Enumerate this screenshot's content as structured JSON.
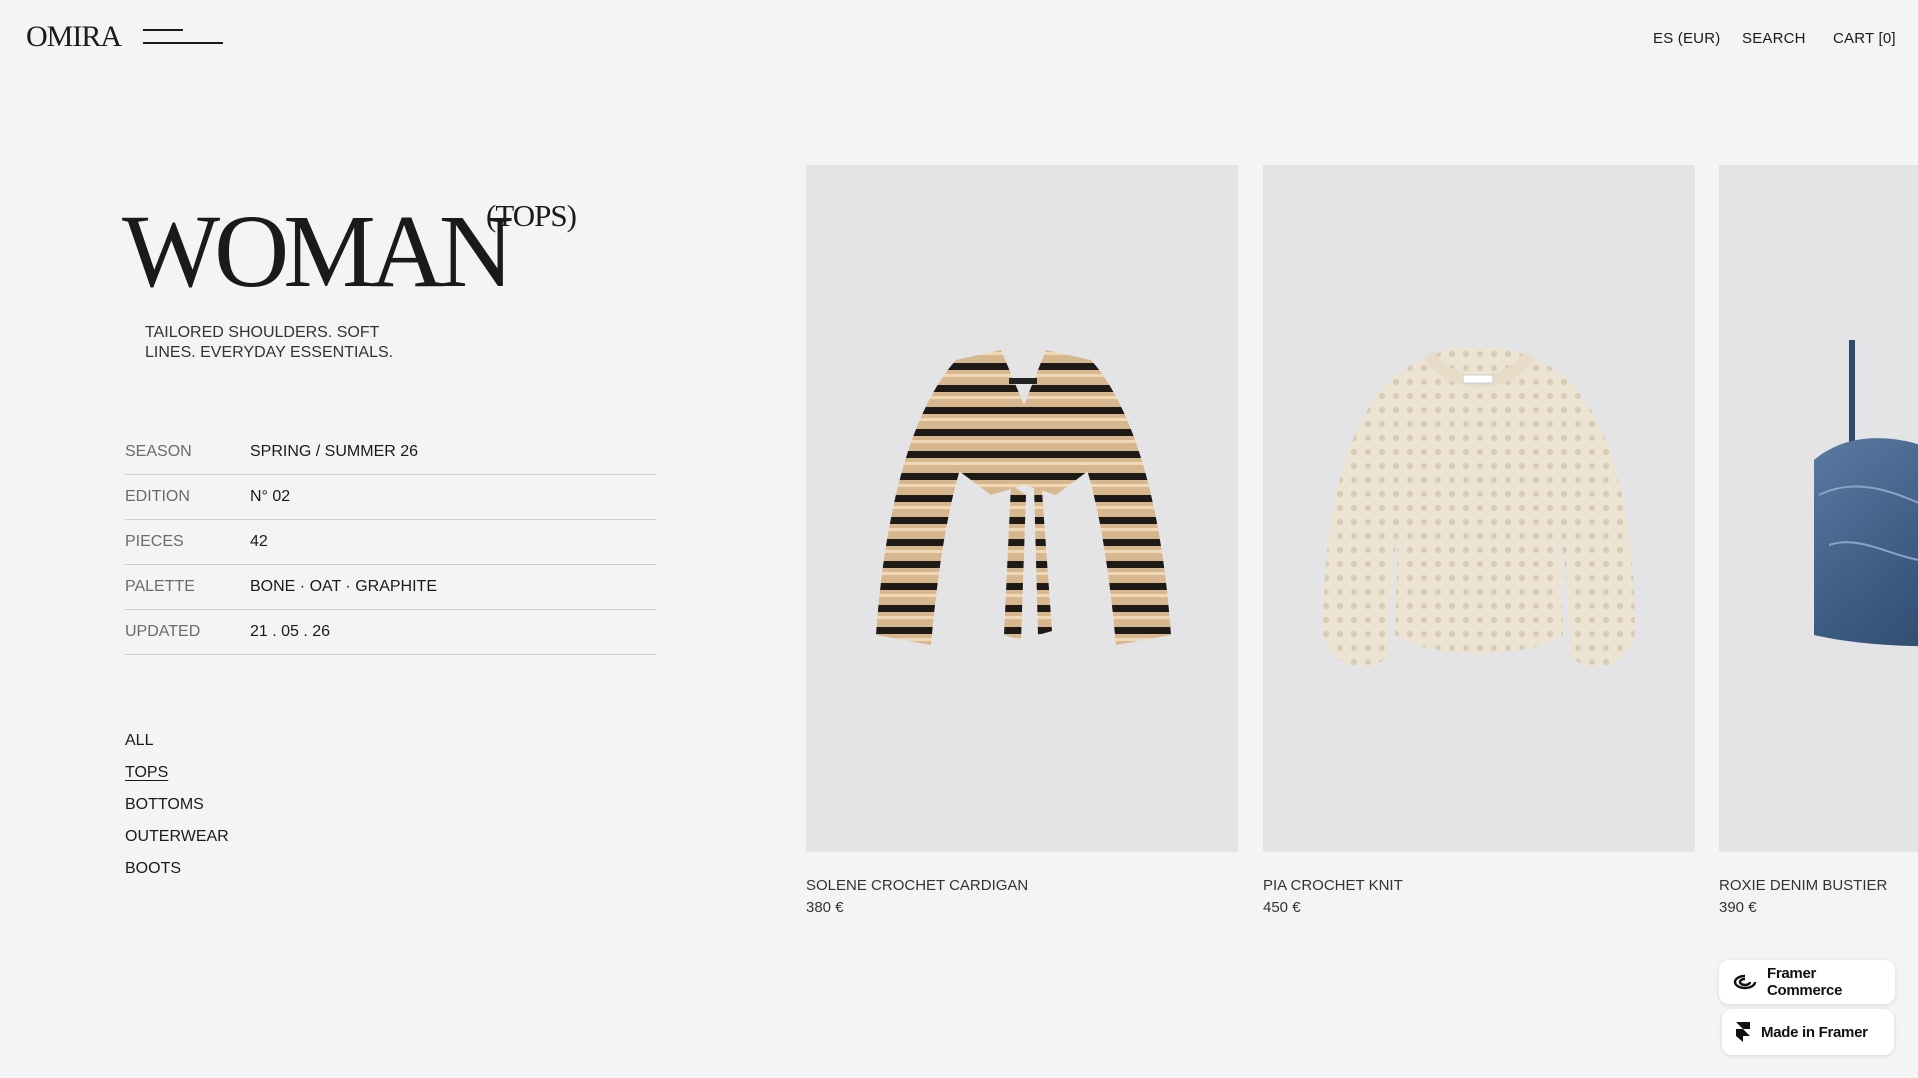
{
  "header": {
    "logo": "OMIRA",
    "region": "ES (EUR)",
    "search": "SEARCH",
    "cart": "CART [0]"
  },
  "hero": {
    "title": "WOMAN",
    "tag": "(TOPS)",
    "description": "TAILORED SHOULDERS. SOFT LINES. EVERYDAY ESSENTIALS."
  },
  "meta": [
    {
      "label": "SEASON",
      "value": "SPRING / SUMMER 26"
    },
    {
      "label": "EDITION",
      "value": "N° 02"
    },
    {
      "label": "PIECES",
      "value": "42"
    },
    {
      "label": "PALETTE",
      "value": "BONE · OAT · GRAPHITE"
    },
    {
      "label": "UPDATED",
      "value": "21 . 05 . 26"
    }
  ],
  "categories": [
    {
      "label": "ALL",
      "active": false
    },
    {
      "label": "TOPS",
      "active": true
    },
    {
      "label": "BOTTOMS",
      "active": false
    },
    {
      "label": "OUTERWEAR",
      "active": false
    },
    {
      "label": "BOOTS",
      "active": false
    }
  ],
  "products": [
    {
      "name": "SOLENE CROCHET CARDIGAN",
      "price": "380 €"
    },
    {
      "name": "PIA CROCHET KNIT",
      "price": "450 €"
    },
    {
      "name": "ROXIE DENIM BUSTIER",
      "price": "390 €"
    }
  ],
  "badges": {
    "commerce": "Framer Commerce",
    "made": "Made in Framer"
  },
  "colors": {
    "background": "#f4f4f4",
    "text": "#1a1a1a",
    "image_bg": "#e4e4e6",
    "crochet_tan": "#d8b68e",
    "knit_cream": "#ece3d2",
    "denim": "#3b5a80"
  }
}
